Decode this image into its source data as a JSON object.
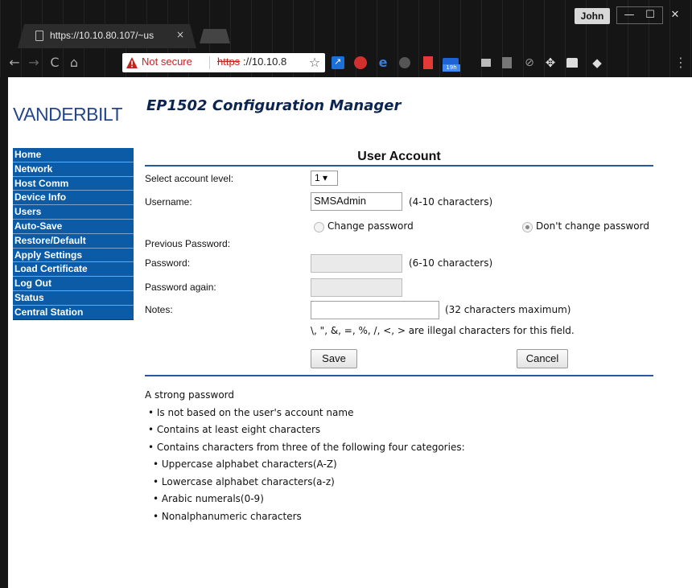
{
  "browser": {
    "tab_title": "https://10.10.80.107/~us",
    "tab_close": "×",
    "profile_name": "John",
    "window_buttons": {
      "minimize": "—",
      "maximize": "☐",
      "close": "✕"
    },
    "nav": {
      "back": "←",
      "forward": "→",
      "reload": "C",
      "home": "⌂"
    },
    "address": {
      "security_label": "Not secure",
      "scheme": "https",
      "host": "://10.10.8",
      "star": "☆"
    },
    "extension_badge": "19h",
    "menu": "⋮"
  },
  "page": {
    "logo_text": "VANDERBILT",
    "title": "EP1502 Configuration Manager",
    "sidebar": {
      "items": [
        {
          "label": "Home"
        },
        {
          "label": "Network"
        },
        {
          "label": "Host Comm"
        },
        {
          "label": "Device Info"
        },
        {
          "label": "Users"
        },
        {
          "label": "Auto-Save"
        },
        {
          "label": "Restore/Default"
        },
        {
          "label": "Apply Settings"
        },
        {
          "label": "Load Certificate"
        },
        {
          "label": "Log Out"
        },
        {
          "label": "Status"
        },
        {
          "label": "Central Station"
        }
      ]
    },
    "form": {
      "section_title": "User Account",
      "account_level_label": "Select account level:",
      "account_level_value": "1 ▾",
      "username_label": "Username:",
      "username_value": "SMSAdmin",
      "username_hint": "(4-10 characters)",
      "change_password_label": "Change password",
      "dont_change_password_label": "Don't change password",
      "previous_password_label": "Previous Password:",
      "password_label": "Password:",
      "password_hint": "(6-10 characters)",
      "password_again_label": "Password again:",
      "notes_label": "Notes:",
      "notes_value": "",
      "notes_hint": "(32 characters maximum)",
      "illegal_chars_note": "\\, \", &, =, %, /, <, > are illegal characters for this field.",
      "save_label": "Save",
      "cancel_label": "Cancel"
    },
    "info": {
      "intro": "A strong password",
      "rules": [
        "• Is not based on the user's account name",
        "• Contains at least eight characters",
        "• Contains characters from three of the following four categories:"
      ],
      "categories": [
        "• Uppercase alphabet characters(A-Z)",
        "• Lowercase alphabet characters(a-z)",
        "• Arabic numerals(0-9)",
        "• Nonalphanumeric characters"
      ]
    }
  }
}
